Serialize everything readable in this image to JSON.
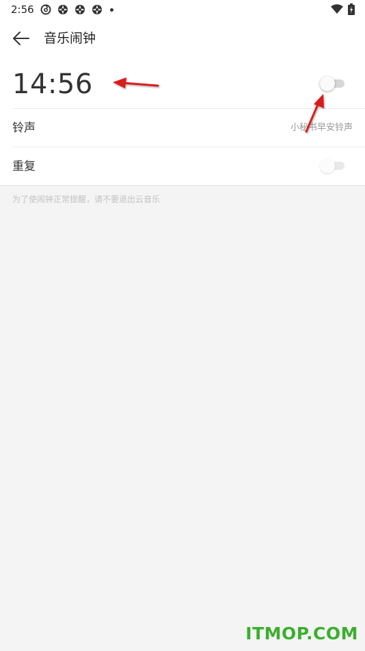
{
  "status_bar": {
    "time": "2:56",
    "icons": [
      "netease-cloud-music-icon",
      "aperture-icon",
      "aperture-icon",
      "aperture-icon",
      "dot-icon",
      "wifi-icon",
      "battery-charging-icon"
    ]
  },
  "app_bar": {
    "back_icon": "arrow-left-icon",
    "title": "音乐闹钟"
  },
  "alarm": {
    "time": "14:56",
    "enabled": false
  },
  "settings": {
    "ringtone_label": "铃声",
    "ringtone_value": "小秘书早安铃声",
    "repeat_label": "重复",
    "repeat_enabled": false
  },
  "hint": "为了使闹钟正常提醒，请不要退出云音乐",
  "watermark": "ITMOP.COM",
  "colors": {
    "annotation_arrow": "#d91c1c",
    "watermark": "#3cae2f",
    "background": "#f4f4f4"
  }
}
